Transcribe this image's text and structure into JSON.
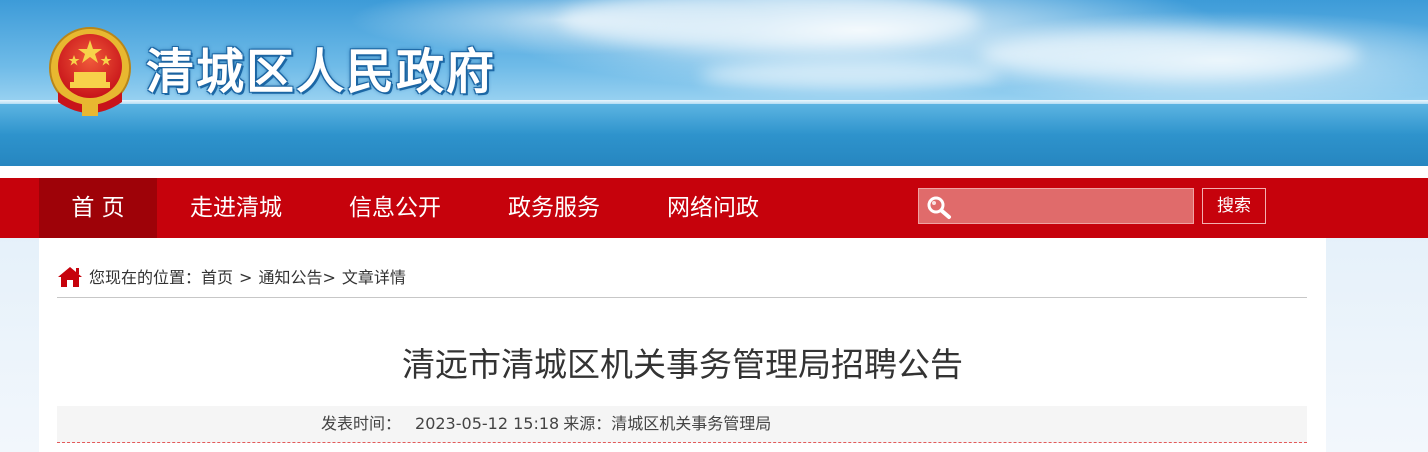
{
  "header": {
    "site_title": "清城区人民政府",
    "emblem_icon": "national-emblem-icon"
  },
  "nav": {
    "items": [
      {
        "label": "首 页",
        "active": true
      },
      {
        "label": "走进清城",
        "active": false
      },
      {
        "label": "信息公开",
        "active": false
      },
      {
        "label": "政务服务",
        "active": false
      },
      {
        "label": "网络问政",
        "active": false
      }
    ],
    "search": {
      "placeholder": "",
      "button_label": "搜索",
      "icon": "search-icon"
    }
  },
  "breadcrumb": {
    "prefix": "您现在的位置：",
    "items": [
      "首页",
      "通知公告",
      "文章详情"
    ],
    "separator": ">",
    "icon": "home-icon"
  },
  "article": {
    "title": "清远市清城区机关事务管理局招聘公告",
    "publish_label": "发表时间：",
    "publish_time": "2023-05-12 15:18",
    "source_label": "来源：",
    "source": "清城区机关事务管理局"
  },
  "colors": {
    "nav_bg": "#c6020c",
    "nav_active_bg": "#9e0208",
    "meta_divider": "#e35a5a"
  }
}
